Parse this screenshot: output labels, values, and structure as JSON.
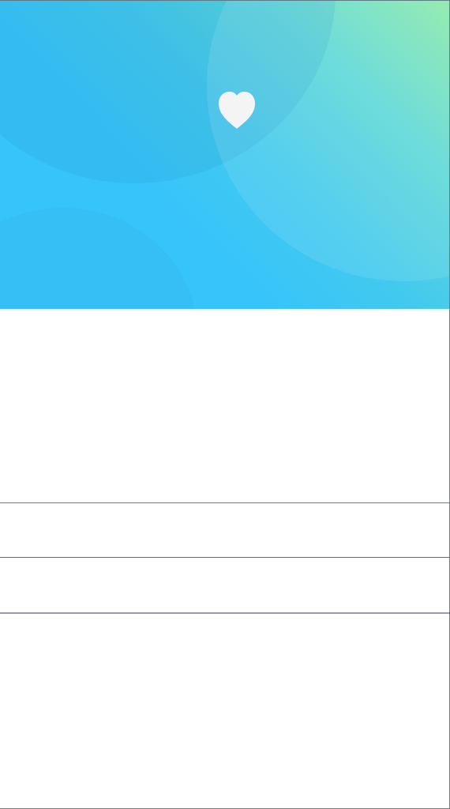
{
  "header": {
    "icon": "heart-icon",
    "colors": {
      "gradient_start": "#37c4fa",
      "gradient_end": "#8aeaa8",
      "icon_fill": "#f4f4f4"
    }
  },
  "list": {
    "rows": [
      {
        "label": ""
      },
      {
        "label": ""
      }
    ]
  }
}
